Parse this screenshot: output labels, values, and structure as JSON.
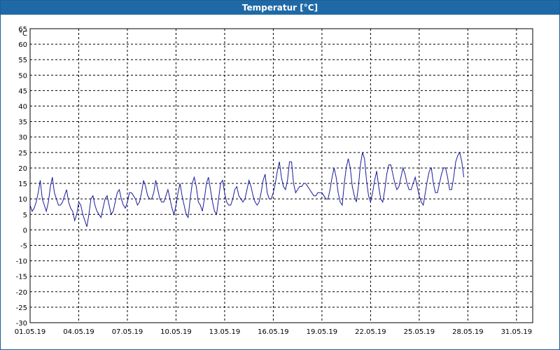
{
  "window": {
    "title": "Temperatur [°C]",
    "title_bar_color": "#1f6aa6"
  },
  "chart_data": {
    "type": "line",
    "title": "Temperatur [°C]",
    "ylabel": "°C",
    "xlabel": "",
    "ylim": [
      -30,
      65
    ],
    "ytick_step": 5,
    "xlim_days": [
      1,
      32
    ],
    "x_ticks": [
      "01.05.19",
      "04.05.19",
      "07.05.19",
      "10.05.19",
      "13.05.19",
      "16.05.19",
      "19.05.19",
      "22.05.19",
      "25.05.19",
      "28.05.19",
      "31.05.19"
    ],
    "grid": true,
    "line_color": "#1a1a9a",
    "series": [
      {
        "x_start": "01.05.19 00:00",
        "x_step_hours": 3,
        "values": [
          8,
          6,
          7,
          9,
          12,
          16,
          10,
          8,
          6,
          9,
          14,
          17,
          12,
          10,
          8,
          8,
          9,
          11,
          13,
          9,
          7,
          6,
          3,
          5,
          9,
          8,
          5,
          3,
          1,
          5,
          10,
          11,
          8,
          6,
          5,
          4,
          7,
          10,
          11,
          8,
          5,
          6,
          9,
          12,
          13,
          10,
          8,
          7,
          9,
          12,
          12,
          11,
          10,
          8,
          9,
          12,
          16,
          14,
          11,
          10,
          10,
          12,
          16,
          13,
          10,
          9,
          9,
          11,
          13,
          10,
          7,
          5,
          8,
          12,
          15,
          11,
          8,
          5,
          4,
          10,
          15,
          17,
          14,
          9,
          8,
          6,
          10,
          15,
          17,
          13,
          9,
          6,
          5,
          10,
          15,
          16,
          12,
          9,
          8,
          8,
          10,
          13,
          14,
          11,
          10,
          9,
          10,
          13,
          16,
          14,
          11,
          9,
          8,
          9,
          12,
          16,
          18,
          12,
          10,
          10,
          12,
          15,
          19,
          22,
          17,
          14,
          13,
          16,
          22,
          22,
          15,
          12,
          13,
          14,
          14,
          15,
          15,
          14,
          13,
          12,
          11,
          11,
          12,
          12,
          12,
          11,
          10,
          10,
          13,
          17,
          20,
          17,
          12,
          9,
          8,
          15,
          20,
          23,
          20,
          14,
          11,
          9,
          14,
          21,
          25,
          23,
          16,
          11,
          9,
          12,
          16,
          19,
          14,
          10,
          9,
          13,
          18,
          21,
          21,
          18,
          15,
          13,
          14,
          17,
          20,
          18,
          15,
          13,
          13,
          15,
          17,
          14,
          11,
          9,
          8,
          12,
          16,
          19,
          20,
          15,
          12,
          12,
          15,
          18,
          20,
          20,
          17,
          13,
          13,
          17,
          22,
          24,
          25,
          22,
          17
        ]
      }
    ]
  }
}
